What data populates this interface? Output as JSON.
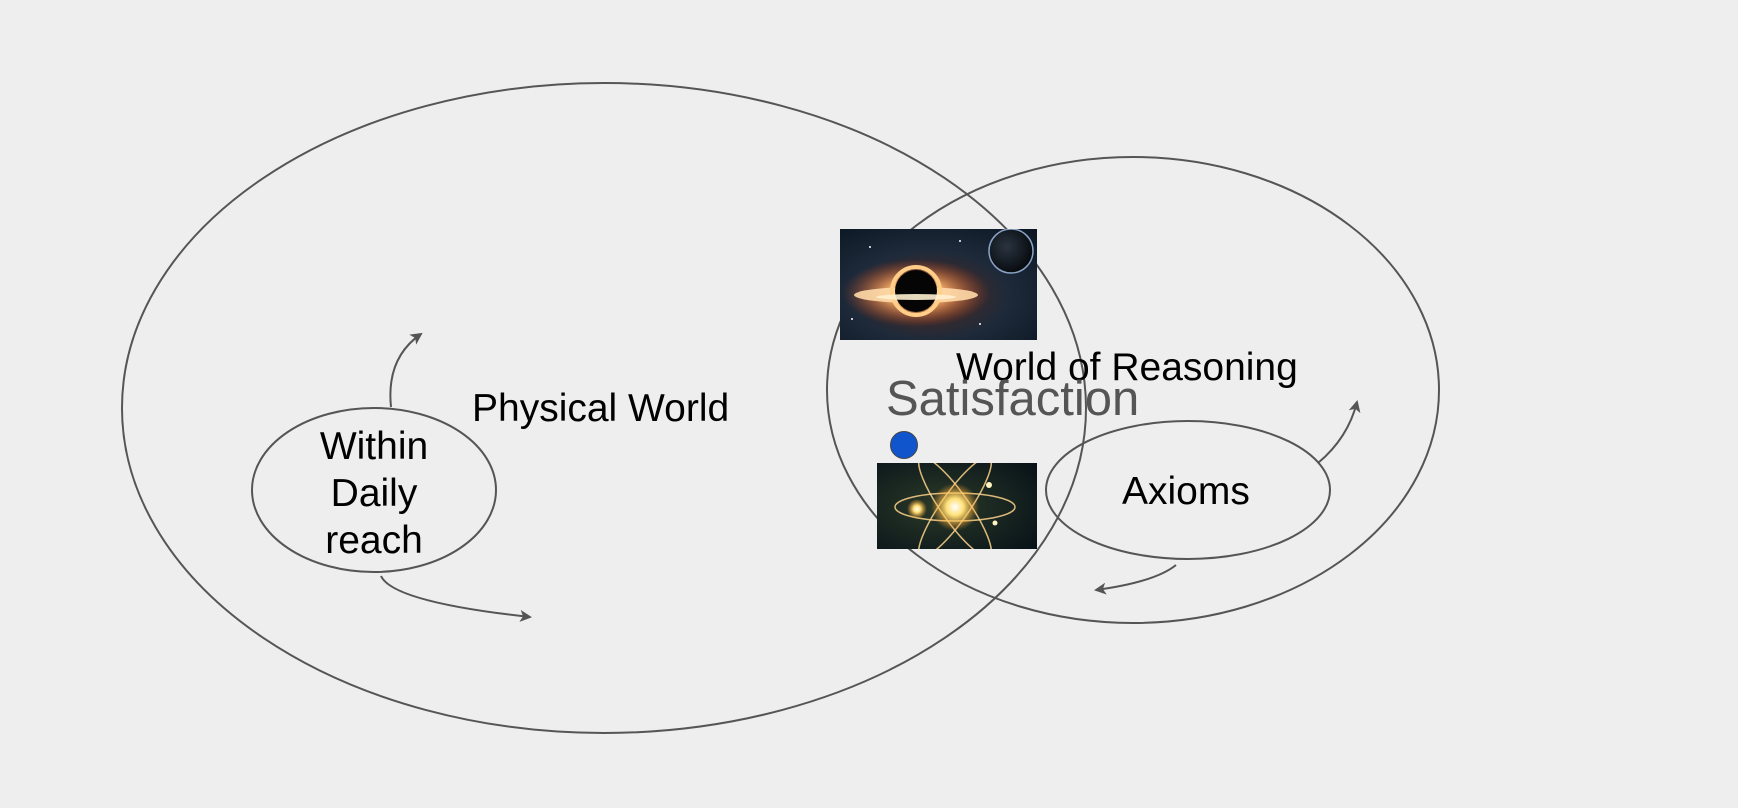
{
  "labels": {
    "physical_world": "Physical World",
    "world_of_reasoning": "World of Reasoning",
    "satisfaction": "Satisfaction",
    "axioms": "Axioms",
    "daily_reach": [
      "Within",
      "Daily",
      "reach"
    ]
  },
  "images": {
    "top": "black-hole-image",
    "bottom": "atom-image"
  },
  "colors": {
    "background": "#eeeeee",
    "stroke": "#555555",
    "satisfaction_text": "#555555",
    "dot": "#1155cc"
  }
}
